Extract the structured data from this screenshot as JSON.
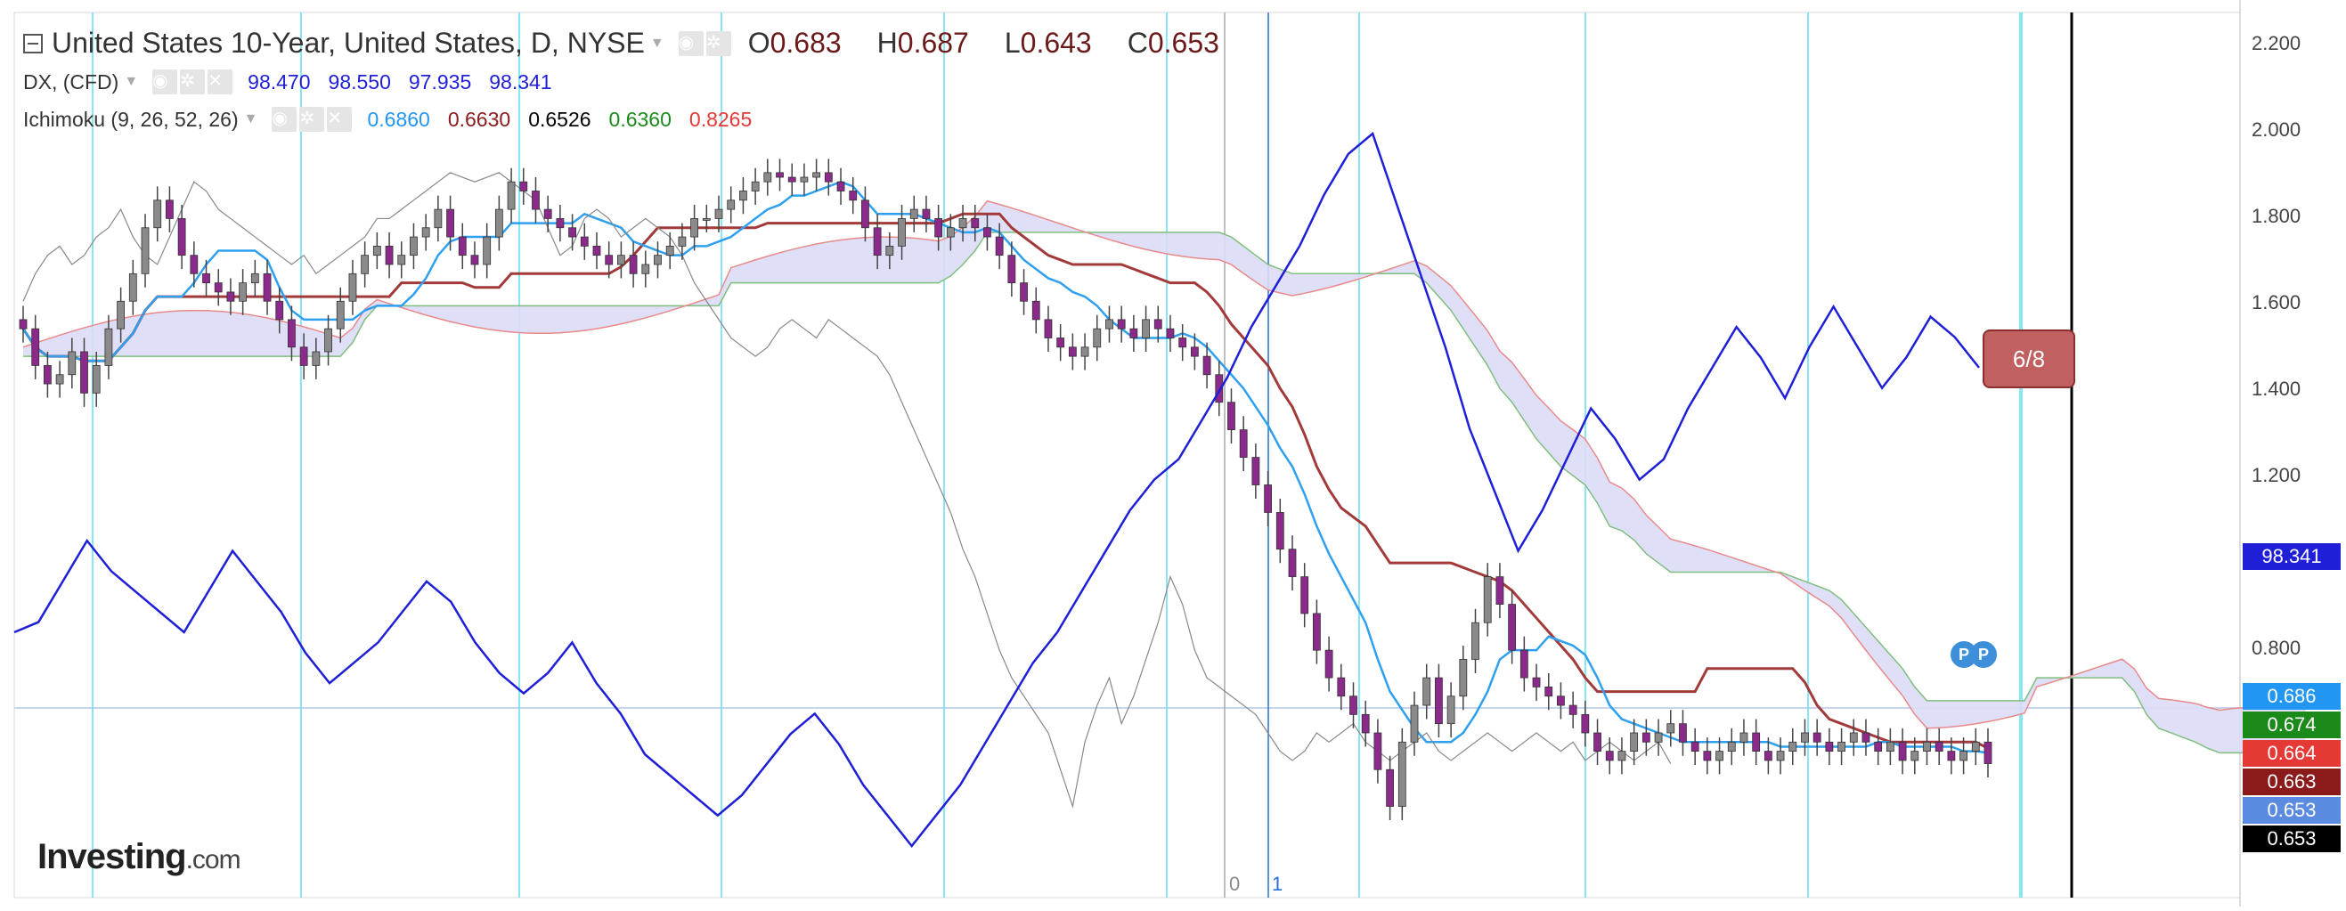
{
  "header": {
    "title": "United States 10-Year, United States, D, NYSE",
    "ohlc": [
      {
        "label": "O",
        "value": "0.683"
      },
      {
        "label": "H",
        "value": "0.687"
      },
      {
        "label": "L",
        "value": "0.643"
      },
      {
        "label": "C",
        "value": "0.653"
      }
    ]
  },
  "overlay": {
    "name": "DX, (CFD)",
    "values": [
      "98.470",
      "98.550",
      "97.935",
      "98.341"
    ]
  },
  "indicator": {
    "name": "Ichimoku (9, 26, 52, 26)",
    "values": [
      {
        "text": "0.6860",
        "color": "#2196f3"
      },
      {
        "text": "0.6630",
        "color": "#8b1a1a"
      },
      {
        "text": "0.6526",
        "color": "#000000"
      },
      {
        "text": "0.6360",
        "color": "#1b8a1b"
      },
      {
        "text": "0.8265",
        "color": "#e53935"
      }
    ]
  },
  "price_tags": [
    {
      "text": "98.341",
      "bg": "#1f1fd8"
    },
    {
      "text": "0.686",
      "bg": "#2196f3"
    },
    {
      "text": "0.674",
      "bg": "#1b8a1b"
    },
    {
      "text": "0.664",
      "bg": "#e53935"
    },
    {
      "text": "0.663",
      "bg": "#8b1a1a"
    },
    {
      "text": "0.653",
      "bg": "#5b8be0"
    },
    {
      "text": "0.653",
      "bg": "#000000"
    }
  ],
  "countdown": "6/8",
  "x_markers": [
    {
      "text": "0",
      "color": "#888888"
    },
    {
      "text": "1",
      "color": "#2a6fd6"
    }
  ],
  "pins": [
    "P",
    "P"
  ],
  "logo": {
    "main": "Investing",
    "suffix": ".com"
  },
  "colors": {
    "candle_up": "#6b6b6b",
    "candle_body": "#8b2a8b",
    "tenkan": "#2ea0ef",
    "kijun": "#a33a3a",
    "chikou": "#888888",
    "dx": "#1f1fd8",
    "cloud_bull": "#d7ecd2",
    "cloud_bear": "#dcdcf6",
    "span_a": "#7fbf7f",
    "span_b": "#e88a8a",
    "cycle_line": "#5ee0f0"
  },
  "chart_data": {
    "type": "line",
    "ylim": [
      0.4,
      2.25
    ],
    "yticks": [
      "2.200",
      "2.000",
      "1.800",
      "1.600",
      "1.400",
      "1.200",
      "0.800"
    ],
    "series": [
      {
        "name": "DX, (CFD)",
        "values": [
          98.1,
          98.2,
          98.6,
          99.0,
          98.7,
          98.5,
          98.3,
          98.1,
          98.5,
          98.9,
          98.6,
          98.3,
          97.9,
          97.6,
          97.8,
          98.0,
          98.3,
          98.6,
          98.4,
          98.0,
          97.7,
          97.5,
          97.7,
          98.0,
          97.6,
          97.3,
          96.9,
          96.7,
          96.5,
          96.3,
          96.5,
          96.8,
          97.1,
          97.3,
          97.0,
          96.6,
          96.3,
          96.0,
          96.3,
          96.6,
          97.0,
          97.4,
          97.8,
          98.1,
          98.5,
          98.9,
          99.3,
          99.6,
          99.8,
          100.2,
          100.6,
          101.1,
          101.5,
          101.9,
          102.4,
          102.8,
          103.0,
          102.3,
          101.6,
          100.9,
          100.1,
          99.5,
          98.9,
          99.3,
          99.8,
          100.3,
          100.0,
          99.6,
          99.8,
          100.3,
          100.7,
          101.1,
          100.8,
          100.4,
          100.9,
          101.3,
          100.9,
          100.5,
          100.8,
          101.2,
          101.0,
          100.7
        ]
      },
      {
        "name": "Tenkan",
        "values": [
          0.686
        ]
      },
      {
        "name": "Kijun",
        "values": [
          0.663
        ]
      },
      {
        "name": "Chikou",
        "values": [
          0.6526
        ]
      },
      {
        "name": "Senkou A",
        "values": [
          0.636
        ]
      },
      {
        "name": "Senkou B",
        "values": [
          0.8265
        ]
      }
    ],
    "candles_close": [
      1.6,
      1.52,
      1.48,
      1.5,
      1.55,
      1.46,
      1.52,
      1.6,
      1.66,
      1.72,
      1.82,
      1.88,
      1.84,
      1.76,
      1.72,
      1.7,
      1.68,
      1.66,
      1.7,
      1.72,
      1.66,
      1.62,
      1.56,
      1.52,
      1.55,
      1.6,
      1.66,
      1.72,
      1.76,
      1.78,
      1.74,
      1.76,
      1.8,
      1.82,
      1.86,
      1.8,
      1.76,
      1.74,
      1.8,
      1.86,
      1.92,
      1.9,
      1.86,
      1.84,
      1.82,
      1.8,
      1.78,
      1.76,
      1.74,
      1.76,
      1.72,
      1.74,
      1.76,
      1.78,
      1.8,
      1.84,
      1.84,
      1.86,
      1.88,
      1.9,
      1.92,
      1.94,
      1.93,
      1.92,
      1.93,
      1.94,
      1.92,
      1.9,
      1.88,
      1.82,
      1.76,
      1.78,
      1.84,
      1.86,
      1.84,
      1.8,
      1.82,
      1.84,
      1.82,
      1.8,
      1.76,
      1.7,
      1.66,
      1.62,
      1.58,
      1.56,
      1.54,
      1.56,
      1.6,
      1.62,
      1.6,
      1.58,
      1.62,
      1.6,
      1.58,
      1.56,
      1.54,
      1.5,
      1.44,
      1.38,
      1.32,
      1.26,
      1.2,
      1.12,
      1.06,
      0.98,
      0.9,
      0.84,
      0.8,
      0.76,
      0.72,
      0.64,
      0.56,
      0.7,
      0.78,
      0.84,
      0.74,
      0.8,
      0.88,
      0.96,
      1.06,
      1.0,
      0.9,
      0.84,
      0.82,
      0.8,
      0.78,
      0.76,
      0.72,
      0.68,
      0.66,
      0.68,
      0.72,
      0.7,
      0.72,
      0.74,
      0.7,
      0.68,
      0.66,
      0.68,
      0.7,
      0.72,
      0.68,
      0.66,
      0.68,
      0.7,
      0.72,
      0.7,
      0.68,
      0.7,
      0.72,
      0.7,
      0.68,
      0.7,
      0.66,
      0.68,
      0.7,
      0.68,
      0.66,
      0.68,
      0.7,
      0.653
    ]
  }
}
